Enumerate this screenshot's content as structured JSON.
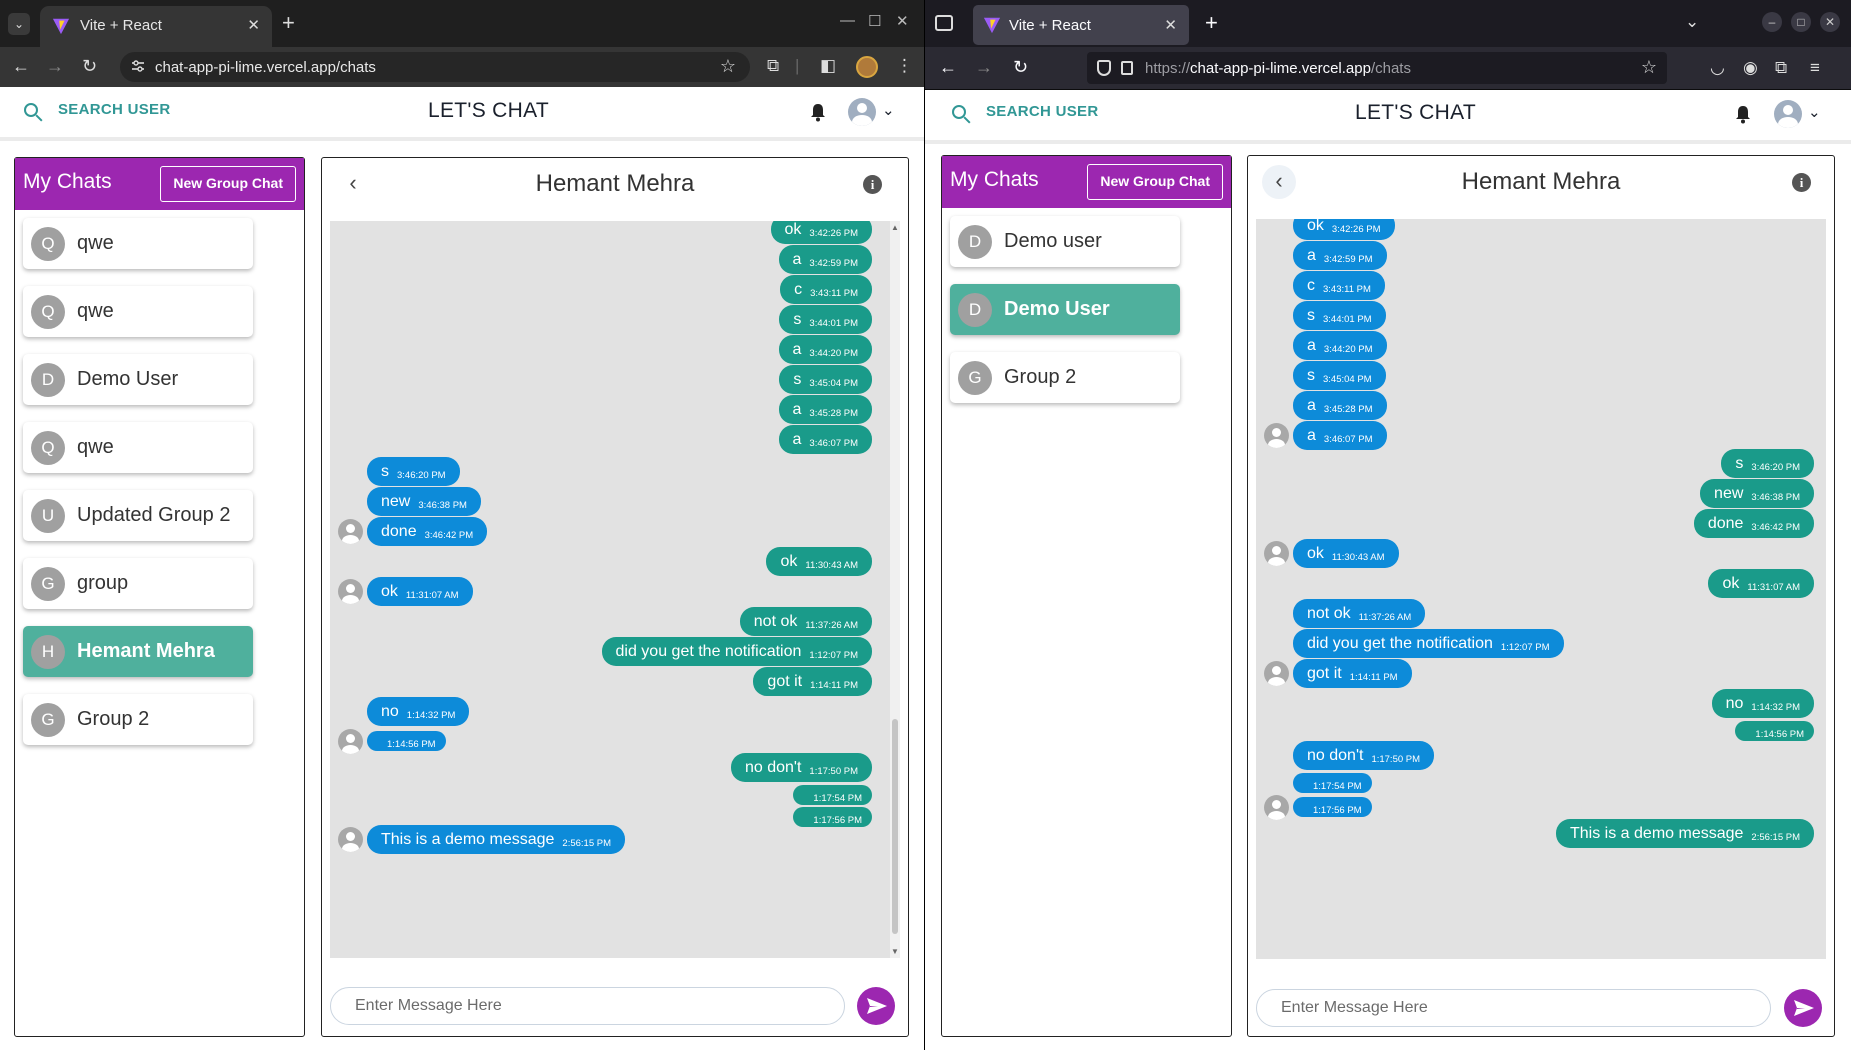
{
  "window1": {
    "tab_title": "Vite + React",
    "url": "chat-app-pi-lime.vercel.app/chats"
  },
  "window2": {
    "tab_title": "Vite + React",
    "url_scheme": "https://",
    "url_host": "chat-app-pi-lime.vercel.app",
    "url_path": "/chats"
  },
  "app": {
    "search_label": "SEARCH USER",
    "title": "LET'S CHAT",
    "my_chats": "My Chats",
    "new_group": "New Group Chat",
    "input_placeholder": "Enter Message Here",
    "colors": {
      "accent": "#9c27b0",
      "teal": "#319795",
      "incoming": "#0d8bd9",
      "outgoing": "#1a9b8a",
      "active_chat": "#4fb09d"
    }
  },
  "left": {
    "chats": [
      {
        "initial": "Q",
        "name": "qwe"
      },
      {
        "initial": "Q",
        "name": "qwe"
      },
      {
        "initial": "D",
        "name": "Demo User"
      },
      {
        "initial": "Q",
        "name": "qwe"
      },
      {
        "initial": "U",
        "name": "Updated Group 2"
      },
      {
        "initial": "G",
        "name": "group"
      },
      {
        "initial": "H",
        "name": "Hemant Mehra"
      },
      {
        "initial": "G",
        "name": "Group 2"
      }
    ],
    "chat_name": "Hemant Mehra",
    "messages": [
      {
        "dir": "out",
        "text": "ok",
        "time": "3:42:26 PM"
      },
      {
        "dir": "out",
        "text": "a",
        "time": "3:42:59 PM"
      },
      {
        "dir": "out",
        "text": "c",
        "time": "3:43:11 PM"
      },
      {
        "dir": "out",
        "text": "s",
        "time": "3:44:01 PM"
      },
      {
        "dir": "out",
        "text": "a",
        "time": "3:44:20 PM"
      },
      {
        "dir": "out",
        "text": "s",
        "time": "3:45:04 PM"
      },
      {
        "dir": "out",
        "text": "a",
        "time": "3:45:28 PM"
      },
      {
        "dir": "out",
        "text": "a",
        "time": "3:46:07 PM"
      },
      {
        "dir": "in",
        "text": "s",
        "time": "3:46:20 PM"
      },
      {
        "dir": "in",
        "text": "new",
        "time": "3:46:38 PM"
      },
      {
        "dir": "in",
        "text": "done",
        "time": "3:46:42 PM"
      },
      {
        "dir": "out",
        "text": "ok",
        "time": "11:30:43 AM"
      },
      {
        "dir": "in",
        "text": "ok",
        "time": "11:31:07 AM"
      },
      {
        "dir": "out",
        "text": "not ok",
        "time": "11:37:26 AM"
      },
      {
        "dir": "out",
        "text": "did you get the notification",
        "time": "1:12:07 PM"
      },
      {
        "dir": "out",
        "text": "got it",
        "time": "1:14:11 PM"
      },
      {
        "dir": "in",
        "text": "no",
        "time": "1:14:32 PM"
      },
      {
        "dir": "in",
        "text": "",
        "time": "1:14:56 PM"
      },
      {
        "dir": "out",
        "text": "no don't",
        "time": "1:17:50 PM"
      },
      {
        "dir": "out",
        "text": "",
        "time": "1:17:54 PM"
      },
      {
        "dir": "out",
        "text": "",
        "time": "1:17:56 PM"
      },
      {
        "dir": "in",
        "text": "This is a demo message",
        "time": "2:56:15 PM"
      }
    ]
  },
  "right": {
    "chats": [
      {
        "initial": "D",
        "name": "Demo user"
      },
      {
        "initial": "D",
        "name": "Demo User"
      },
      {
        "initial": "G",
        "name": "Group 2"
      }
    ],
    "chat_name": "Hemant Mehra",
    "messages": [
      {
        "dir": "in",
        "text": "ok",
        "time": "3:42:26 PM"
      },
      {
        "dir": "in",
        "text": "a",
        "time": "3:42:59 PM"
      },
      {
        "dir": "in",
        "text": "c",
        "time": "3:43:11 PM"
      },
      {
        "dir": "in",
        "text": "s",
        "time": "3:44:01 PM"
      },
      {
        "dir": "in",
        "text": "a",
        "time": "3:44:20 PM"
      },
      {
        "dir": "in",
        "text": "s",
        "time": "3:45:04 PM"
      },
      {
        "dir": "in",
        "text": "a",
        "time": "3:45:28 PM"
      },
      {
        "dir": "in",
        "text": "a",
        "time": "3:46:07 PM"
      },
      {
        "dir": "out",
        "text": "s",
        "time": "3:46:20 PM"
      },
      {
        "dir": "out",
        "text": "new",
        "time": "3:46:38 PM"
      },
      {
        "dir": "out",
        "text": "done",
        "time": "3:46:42 PM"
      },
      {
        "dir": "in",
        "text": "ok",
        "time": "11:30:43 AM"
      },
      {
        "dir": "out",
        "text": "ok",
        "time": "11:31:07 AM"
      },
      {
        "dir": "in",
        "text": "not ok",
        "time": "11:37:26 AM"
      },
      {
        "dir": "in",
        "text": "did you get the notification",
        "time": "1:12:07 PM"
      },
      {
        "dir": "in",
        "text": "got it",
        "time": "1:14:11 PM"
      },
      {
        "dir": "out",
        "text": "no",
        "time": "1:14:32 PM"
      },
      {
        "dir": "out",
        "text": "",
        "time": "1:14:56 PM"
      },
      {
        "dir": "in",
        "text": "no don't",
        "time": "1:17:50 PM"
      },
      {
        "dir": "in",
        "text": "",
        "time": "1:17:54 PM"
      },
      {
        "dir": "in",
        "text": "",
        "time": "1:17:56 PM"
      },
      {
        "dir": "out",
        "text": "This is a demo message",
        "time": "2:56:15 PM"
      }
    ]
  }
}
